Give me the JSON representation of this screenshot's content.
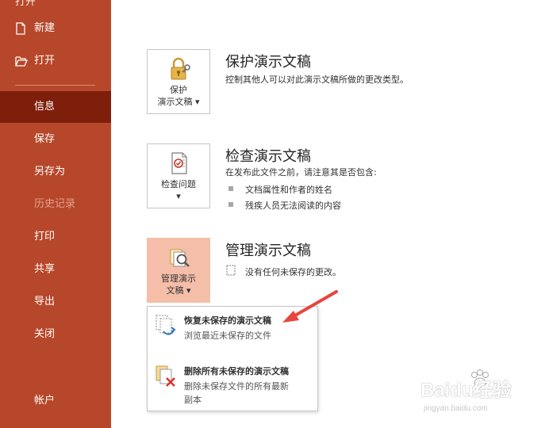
{
  "sidebar": {
    "top_cut_label": "打开",
    "items": [
      {
        "label": "新建",
        "icon": "new-doc-icon"
      },
      {
        "label": "打开",
        "icon": "open-folder-icon"
      },
      {
        "label": "信息",
        "active": true
      },
      {
        "label": "保存"
      },
      {
        "label": "另存为"
      },
      {
        "label": "历史记录",
        "disabled": true
      },
      {
        "label": "打印"
      },
      {
        "label": "共享"
      },
      {
        "label": "导出"
      },
      {
        "label": "关闭"
      },
      {
        "label": "帐户"
      }
    ],
    "colors": {
      "background": "#b7472a",
      "active": "#7e1f0b"
    }
  },
  "sections": {
    "protect": {
      "tile_label_1": "保护",
      "tile_label_2": "演示文稿 ▾",
      "title": "保护演示文稿",
      "desc": "控制其他人可以对此演示文稿所做的更改类型。",
      "icon": "lock-key-icon"
    },
    "inspect": {
      "tile_label_1": "检查问题",
      "tile_label_2": "▾",
      "title": "检查演示文稿",
      "desc": "在发布此文件之前，请注意其是否包含:",
      "bullets": [
        "文档属性和作者的姓名",
        "残疾人员无法阅读的内容"
      ],
      "icon": "inspect-document-icon"
    },
    "manage": {
      "tile_label_1": "管理演示",
      "tile_label_2": "文稿 ▾",
      "title": "管理演示文稿",
      "desc": "没有任何未保存的更改。",
      "icon": "manage-document-icon",
      "highlight_color": "#f5bea8"
    }
  },
  "dropdown": {
    "items": [
      {
        "title": "恢复未保存的演示文稿",
        "desc": "浏览最近未保存的文件",
        "icon": "recover-document-icon"
      },
      {
        "title": "删除所有未保存的演示文稿",
        "desc_1": "删除未保存文件的所有最新",
        "desc_2": "副本",
        "icon": "delete-documents-icon"
      }
    ]
  },
  "annotation": {
    "arrow_color": "#e8453c"
  },
  "watermark": {
    "brand": "Baidu经验",
    "sub": "jingyan.baidu.com"
  }
}
